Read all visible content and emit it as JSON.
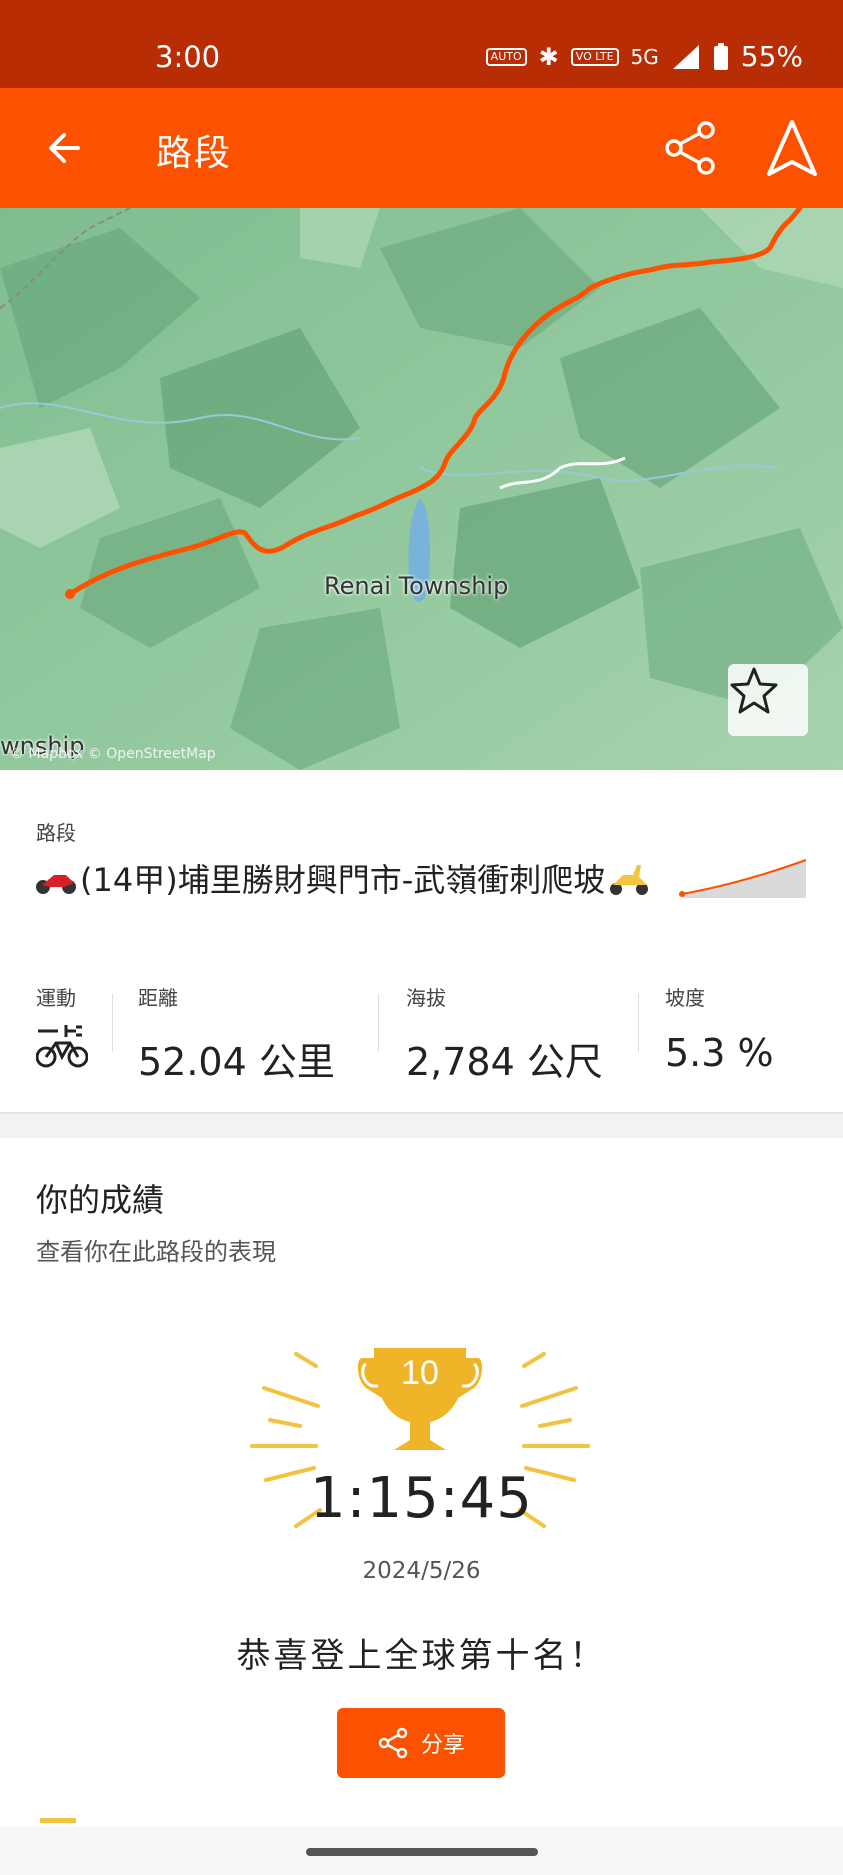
{
  "status_bar": {
    "time": "3:00",
    "badge_auto": "AUTO",
    "badge_volte": "VO LTE",
    "network": "5G",
    "battery": "55%"
  },
  "app_bar": {
    "title": "路段",
    "icons": [
      "back-arrow-icon",
      "share-icon",
      "navigate-icon"
    ]
  },
  "map": {
    "place_label": "Renai Township",
    "edge_label": "wnship",
    "attribution": "© Mapbox © OpenStreetMap",
    "route_color": "#fc5200",
    "favorite_icon": "star-outline-icon"
  },
  "segment": {
    "section_label": "路段",
    "name_text": "(14甲)埔里勝財興門市-武嶺衝刺爬坡",
    "leading_emoji": "motorcycle",
    "trailing_emoji": "scooter",
    "stats": {
      "sport": {
        "label": "運動",
        "icon": "e-bike-icon"
      },
      "distance": {
        "label": "距離",
        "value": "52.04 公里"
      },
      "elevation": {
        "label": "海拔",
        "value": "2,784 公尺"
      },
      "grade": {
        "label": "坡度",
        "value": "5.3 %"
      }
    }
  },
  "performance": {
    "title": "你的成績",
    "subtitle": "查看你在此路段的表現",
    "rank_number": "10",
    "time": "1:15:45",
    "date": "2024/5/26",
    "congrats": "恭喜登上全球第十名！",
    "share_label": "分享"
  },
  "colors": {
    "brand": "#fc5200",
    "status_bar": "#b92d05",
    "trophy": "#f0b429"
  }
}
